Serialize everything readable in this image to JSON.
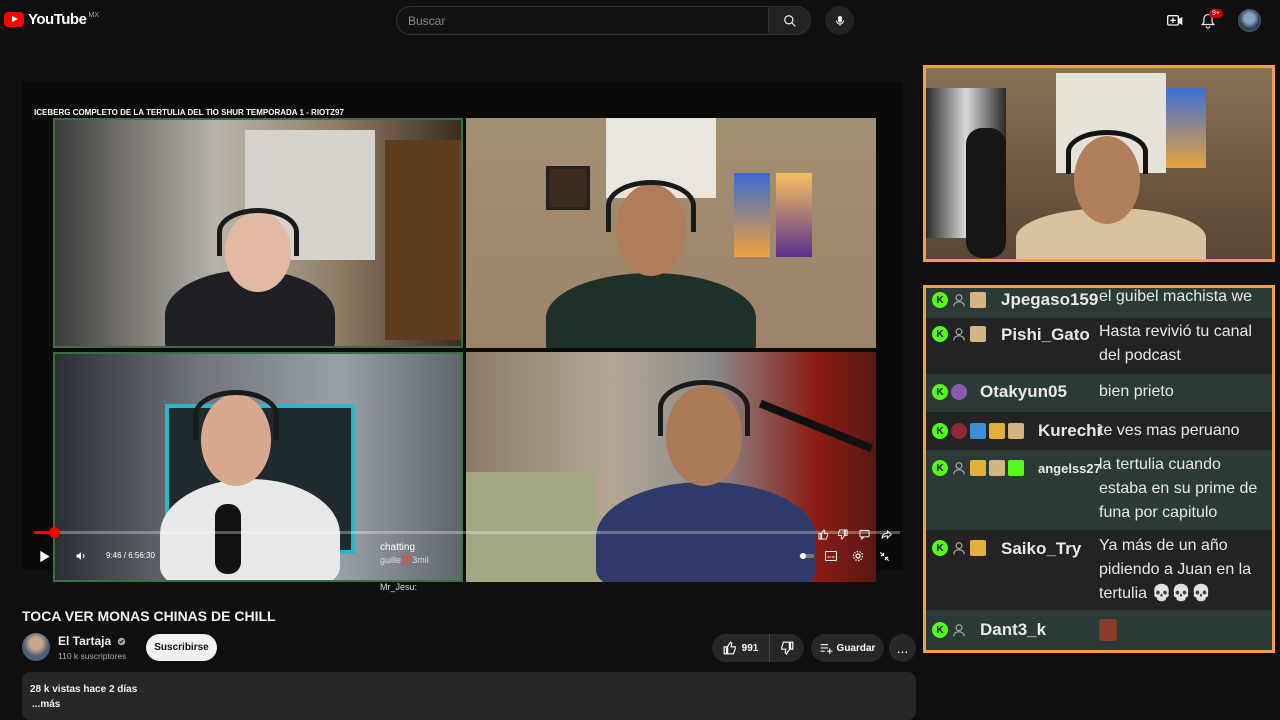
{
  "header": {
    "logo_text": "YouTube",
    "country_code": "MX",
    "search_placeholder": "Buscar",
    "notif_count": "9+",
    "icons": [
      "menu-icon",
      "search-icon",
      "mic-icon",
      "create-icon",
      "bell-icon",
      "avatar"
    ]
  },
  "player": {
    "video_title": "ICEBERG COMPLETO DE LA TERTULIA DEL TIO SHUR TEMPORADA 1 - RIOTZ97",
    "time_label": "9:46 / 6:56:30",
    "progress_fraction": 0.0235,
    "overlay_chat": {
      "label": "chatting",
      "lines": [
        "guille💯3mil",
        "Mr_Jesu:"
      ]
    }
  },
  "watch": {
    "title": "TOCA VER MONAS CHINAS DE CHILL",
    "channel_name": "El Tartaja",
    "subscribers": "110 k suscriptores",
    "subscribe_label": "Suscribirse",
    "likes": "991",
    "save_label": "Guardar",
    "more_label": "...",
    "views_date": "28 k vistas  hace 2 días",
    "more_text": "...más"
  },
  "chat": {
    "messages": [
      {
        "user": "Jpegaso159",
        "text": "el guibel machista we",
        "avatar": "default",
        "badges": [
          "sub"
        ]
      },
      {
        "user": "Pishi_Gato",
        "text": "Hasta revivió tu canal del podcast",
        "avatar": "default",
        "badges": [
          "sub"
        ]
      },
      {
        "user": "Otakyun05",
        "text": "bien prieto",
        "avatar": "purple",
        "badges": []
      },
      {
        "user": "Kurechi",
        "text": "te ves mas peruano",
        "avatar": "red",
        "badges": [
          "pick",
          "crown",
          "sub"
        ]
      },
      {
        "user": "angelss27",
        "text": "la tertulia cuando estaba en su prime de funa por capitulo",
        "avatar": "default",
        "badges": [
          "crown",
          "sub",
          "gift"
        ]
      },
      {
        "user": "Saiko_Try",
        "text": "Ya más de un año pidiendo a Juan en la tertulia 💀💀💀",
        "avatar": "default",
        "badges": [
          "crown"
        ]
      },
      {
        "user": "Dant3_k",
        "text": "",
        "avatar": "default",
        "badges": [],
        "emote": "moai-emote"
      }
    ]
  },
  "colors": {
    "accent_orange": "#f0a04b",
    "kick_green": "#53fc18",
    "youtube_red": "#ff0000"
  }
}
